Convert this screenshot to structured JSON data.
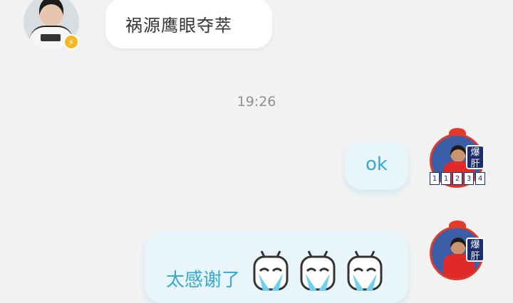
{
  "messages": {
    "received": {
      "text": "祸源鹰眼夺萃",
      "vip_badge": "⚡"
    },
    "timestamp": "19:26",
    "sent_ok": {
      "text": "ok"
    },
    "sent_thanks": {
      "text": "太感谢了"
    },
    "sender_avatar_tag": "爆肝",
    "sender_avatar_numbers": [
      "1",
      "1",
      "2",
      "3",
      "4"
    ]
  },
  "colors": {
    "background": "#f2f2f2",
    "sent_bubble": "#e8f6fc",
    "sent_text": "#36a8d4",
    "received_bubble": "#ffffff",
    "received_text": "#333333",
    "timestamp": "#8f8f8f"
  }
}
